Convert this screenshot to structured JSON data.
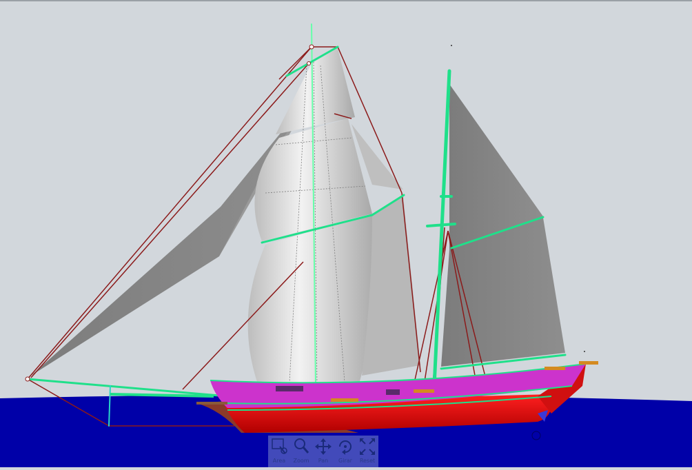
{
  "scene": {
    "sky_color": "#d2d7dc",
    "sea_color": "#0000a8",
    "hull_color": "#e00000",
    "bulwark_color": "#cc33cc",
    "spar_color": "#1fe08a",
    "sail_color": "#8a8a8a",
    "rigging_color": "#8b1a1a"
  },
  "toolbar": {
    "tools": [
      {
        "label": "Area",
        "icon": "area-select-icon"
      },
      {
        "label": "Zoom",
        "icon": "magnifier-icon"
      },
      {
        "label": "Pan",
        "icon": "pan-arrows-icon"
      },
      {
        "label": "Girar",
        "icon": "rotate-icon"
      },
      {
        "label": "Reset",
        "icon": "reset-expand-icon"
      }
    ]
  }
}
